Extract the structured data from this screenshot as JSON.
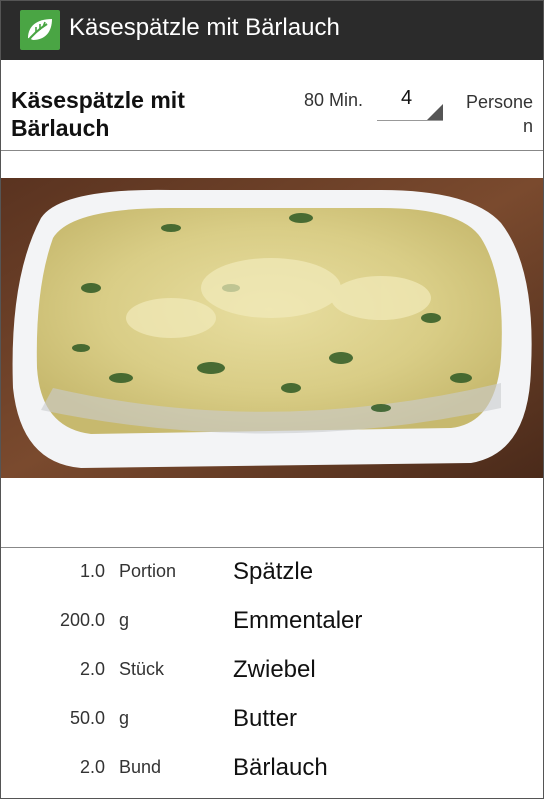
{
  "app_bar": {
    "title": "Käsespätzle mit Bärlauch",
    "icon": "leaf-logo-icon",
    "icon_color": "#4aa544",
    "background": "#2b2b2b"
  },
  "recipe": {
    "title": "Käsespätzle mit Bärlauch",
    "duration": "80 Min.",
    "servings": "4",
    "servings_unit": "Personen"
  },
  "photo": {
    "subject": "käsespätzle-baking-dish-photo"
  },
  "ingredients": [
    {
      "qty": "1.0",
      "unit": "Portion",
      "name": "Spätzle"
    },
    {
      "qty": "200.0",
      "unit": "g",
      "name": "Emmentaler"
    },
    {
      "qty": "2.0",
      "unit": "Stück",
      "name": "Zwiebel"
    },
    {
      "qty": "50.0",
      "unit": "g",
      "name": "Butter"
    },
    {
      "qty": "2.0",
      "unit": "Bund",
      "name": "Bärlauch"
    }
  ]
}
